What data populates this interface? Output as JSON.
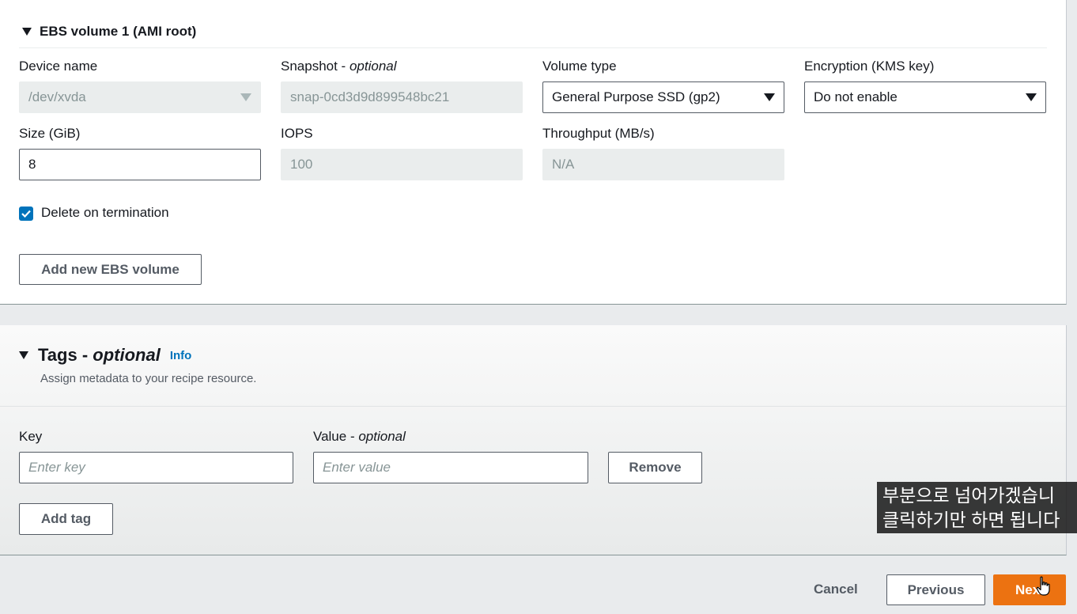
{
  "ebs": {
    "section_title": "EBS volume 1 (AMI root)",
    "device_name": {
      "label": "Device name",
      "value": "/dev/xvda"
    },
    "snapshot": {
      "label": "Snapshot - ",
      "label_optional": "optional",
      "value": "snap-0cd3d9d899548bc21"
    },
    "volume_type": {
      "label": "Volume type",
      "value": "General Purpose SSD (gp2)"
    },
    "encryption": {
      "label": "Encryption (KMS key)",
      "value": "Do not enable"
    },
    "size": {
      "label": "Size (GiB)",
      "value": "8"
    },
    "iops": {
      "label": "IOPS",
      "value": "100"
    },
    "throughput": {
      "label": "Throughput (MB/s)",
      "value": "N/A"
    },
    "delete_on_termination": {
      "label": "Delete on termination",
      "checked": true
    },
    "add_volume_label": "Add new EBS volume"
  },
  "tags": {
    "title": "Tags - ",
    "title_optional": "optional",
    "info": "Info",
    "description": "Assign metadata to your recipe resource.",
    "key": {
      "label": "Key",
      "placeholder": "Enter key"
    },
    "value": {
      "label": "Value - ",
      "label_optional": "optional",
      "placeholder": "Enter value"
    },
    "remove_label": "Remove",
    "add_tag_label": "Add tag"
  },
  "subtitle": {
    "line1": "부분으로 넘어가겠습니",
    "line2": "클릭하기만 하면 됩니다"
  },
  "footer": {
    "cancel": "Cancel",
    "previous": "Previous",
    "next": "Next"
  },
  "colors": {
    "accent": "#ec7211",
    "link": "#0073bb",
    "checkbox": "#0073bb"
  }
}
